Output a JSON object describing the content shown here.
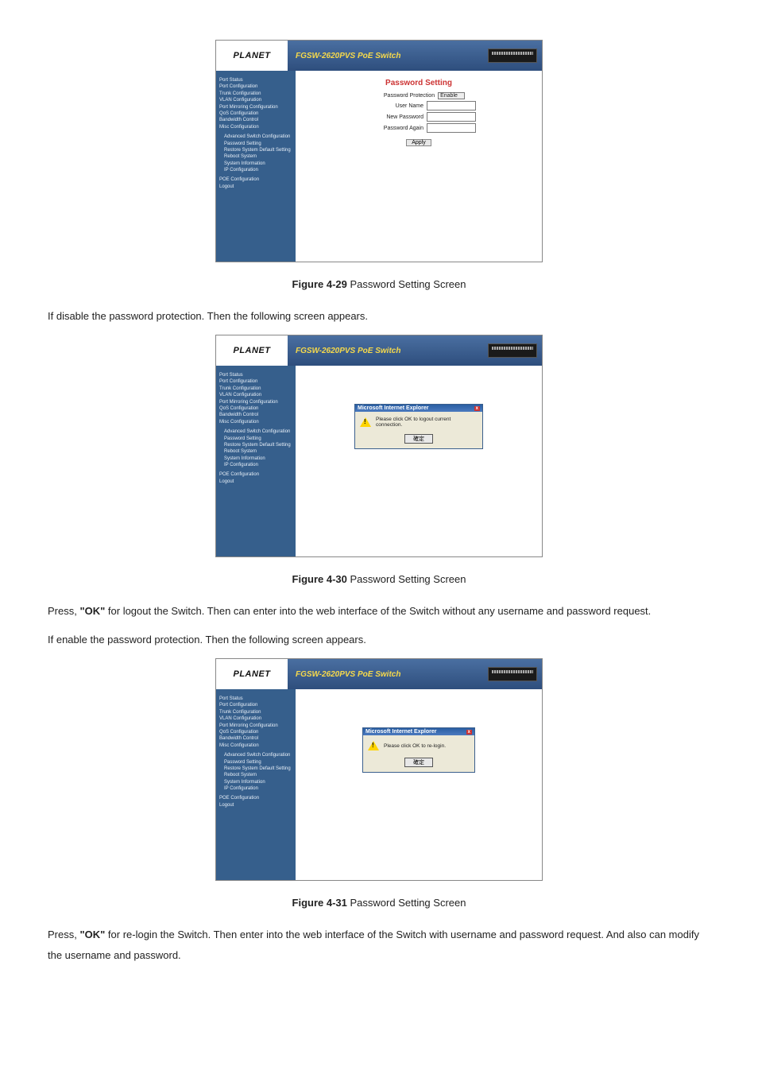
{
  "brand": "PLANET",
  "product_title": "FGSW-2620PVS PoE Switch",
  "nav": {
    "items": [
      "Port Status",
      "Port Configuration",
      "Trunk Configuration",
      "VLAN Configuration",
      "Port Mirroring Configuration",
      "QoS Configuration",
      "Bandwidth Control",
      "Misc Configuration"
    ],
    "sub_items": [
      "Advanced Switch Configuration",
      "Password Setting",
      "Restore System Default Setting",
      "Reboot System",
      "System Information",
      "IP Configuration"
    ],
    "bottom_items": [
      "POE Configuration",
      "Logout"
    ]
  },
  "password_panel": {
    "heading": "Password Setting",
    "protection_label": "Password Protection",
    "protection_value": "Enable",
    "user_label": "User Name",
    "new_pw_label": "New Password",
    "again_label": "Password Again",
    "apply": "Apply"
  },
  "dialog": {
    "title": "Microsoft Internet Explorer",
    "close": "x",
    "msg_logout": "Please click OK to logout current connection.",
    "msg_relogin": "Please click OK to re-login.",
    "ok_wide": "確定"
  },
  "captions": {
    "c1_bold": "Figure 4-29",
    "c1_rest": " Password Setting Screen",
    "c2_bold": "Figure 4-30",
    "c2_rest": " Password Setting Screen",
    "c3_bold": "Figure 4-31",
    "c3_rest": " Password Setting Screen"
  },
  "paras": {
    "p1": "If disable the password protection. Then the following screen appears.",
    "p2a": "Press, ",
    "p2b": "\"OK\"",
    "p2c": " for logout the Switch. Then can enter into the web interface of the Switch without any username and password request.",
    "p3": "If enable the password protection. Then the following screen appears.",
    "p4a": "Press, ",
    "p4b": "\"OK\"",
    "p4c": " for re-login the Switch. Then enter into the web interface of the Switch with username and password request. And also can modify the username and password."
  }
}
